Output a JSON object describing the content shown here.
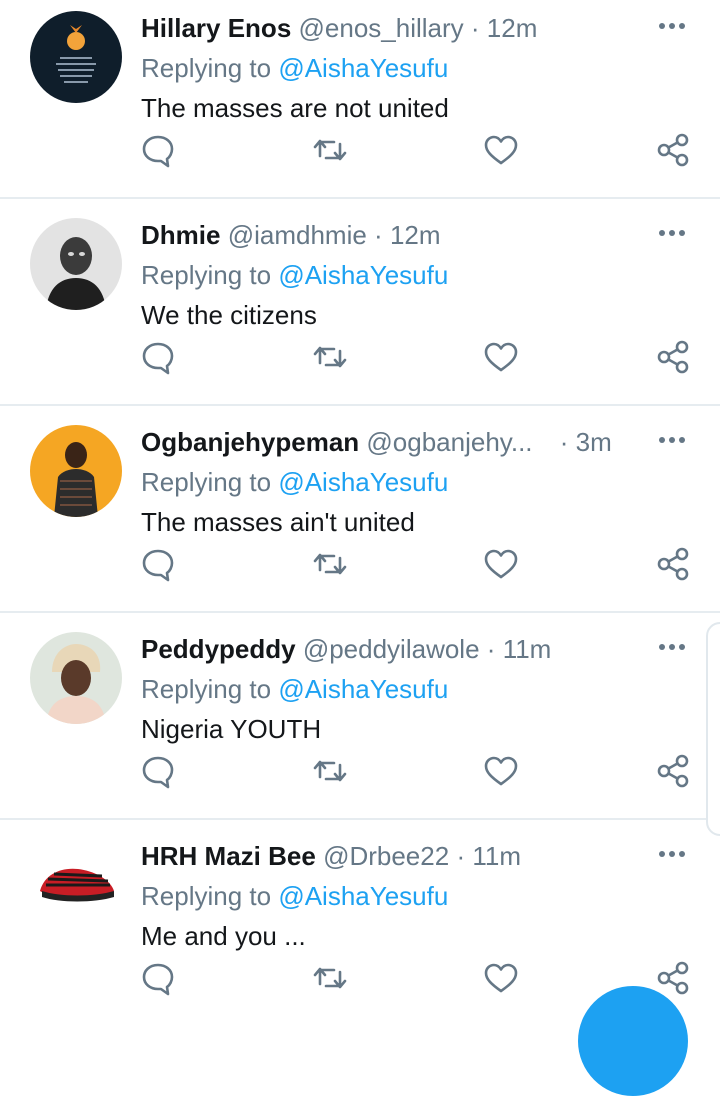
{
  "colors": {
    "accent": "#1da1f2",
    "muted": "#657786",
    "text": "#14171a",
    "divider": "#e6ecf0"
  },
  "tweets": [
    {
      "name": "Hillary Enos",
      "handle": "@enos_hillary",
      "dot": "·",
      "time": "12m",
      "replying": "Replying to",
      "mention": "@AishaYesufu",
      "text": "The masses are not united",
      "avatar_icon": "flower-quote-image"
    },
    {
      "name": "Dhmie",
      "handle": "@iamdhmie",
      "dot": "·",
      "time": "12m",
      "replying": "Replying to",
      "mention": "@AishaYesufu",
      "text": "We the citizens",
      "avatar_icon": "man-bw-photo"
    },
    {
      "name": "Ogbanjehypeman",
      "handle": "@ogbanjehy...",
      "dot": "·",
      "time": "3m",
      "replying": "Replying to",
      "mention": "@AishaYesufu",
      "text": "The masses ain't united",
      "avatar_icon": "man-orange-bg-photo"
    },
    {
      "name": "Peddypeddy",
      "handle": "@peddyilawole",
      "dot": "·",
      "time": "11m",
      "replying": "Replying to",
      "mention": "@AishaYesufu",
      "text": "Nigeria YOUTH",
      "avatar_icon": "woman-headwrap-photo"
    },
    {
      "name": "HRH Mazi Bee",
      "handle": "@Drbee22",
      "dot": "·",
      "time": "11m",
      "replying": "Replying to",
      "mention": "@AishaYesufu",
      "text": "Me and you ...",
      "avatar_icon": "red-striped-cap-photo"
    }
  ],
  "actions": [
    "comment-icon",
    "retweet-icon",
    "like-icon",
    "share-icon"
  ],
  "fab": {
    "icon": "compose-icon"
  }
}
